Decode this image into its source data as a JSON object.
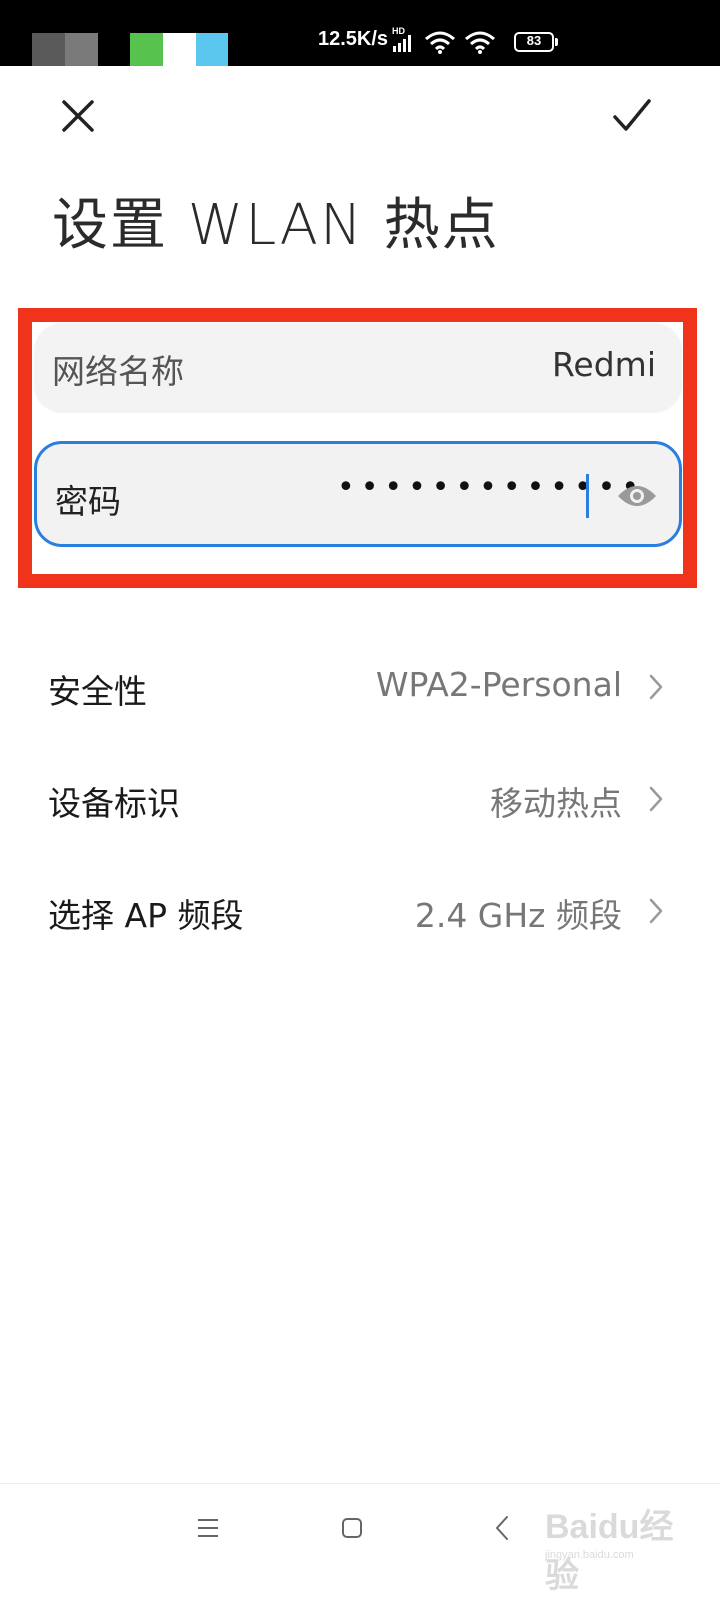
{
  "status_bar": {
    "network_speed": "12.5K/s",
    "hd_label": "HD",
    "battery": "83",
    "color_blocks": [
      "#5a5a5a",
      "#7a7a7a",
      "#000000",
      "#57c24d",
      "#ffffff",
      "#5bc7ef"
    ]
  },
  "header": {
    "close_icon": "close-icon",
    "confirm_icon": "check-icon"
  },
  "title": "设置 WLAN 热点",
  "form": {
    "network_name_label": "网络名称",
    "network_name_value": "Redmi",
    "password_label": "密码",
    "password_mask": "•••••••••••••",
    "show_password_icon": "eye-icon"
  },
  "settings": [
    {
      "label": "安全性",
      "value": "WPA2-Personal"
    },
    {
      "label": "设备标识",
      "value": "移动热点"
    },
    {
      "label": "选择 AP 频段",
      "value": "2.4 GHz 频段"
    }
  ],
  "nav": {
    "menu_icon": "menu-icon",
    "home_icon": "home-icon",
    "back_icon": "back-icon"
  },
  "watermark": {
    "text": "Baidu经验",
    "sub": "jingyan.baidu.com"
  },
  "colors": {
    "accent": "#2a7de1",
    "highlight": "#f0341c",
    "field_bg": "#f3f3f3"
  }
}
